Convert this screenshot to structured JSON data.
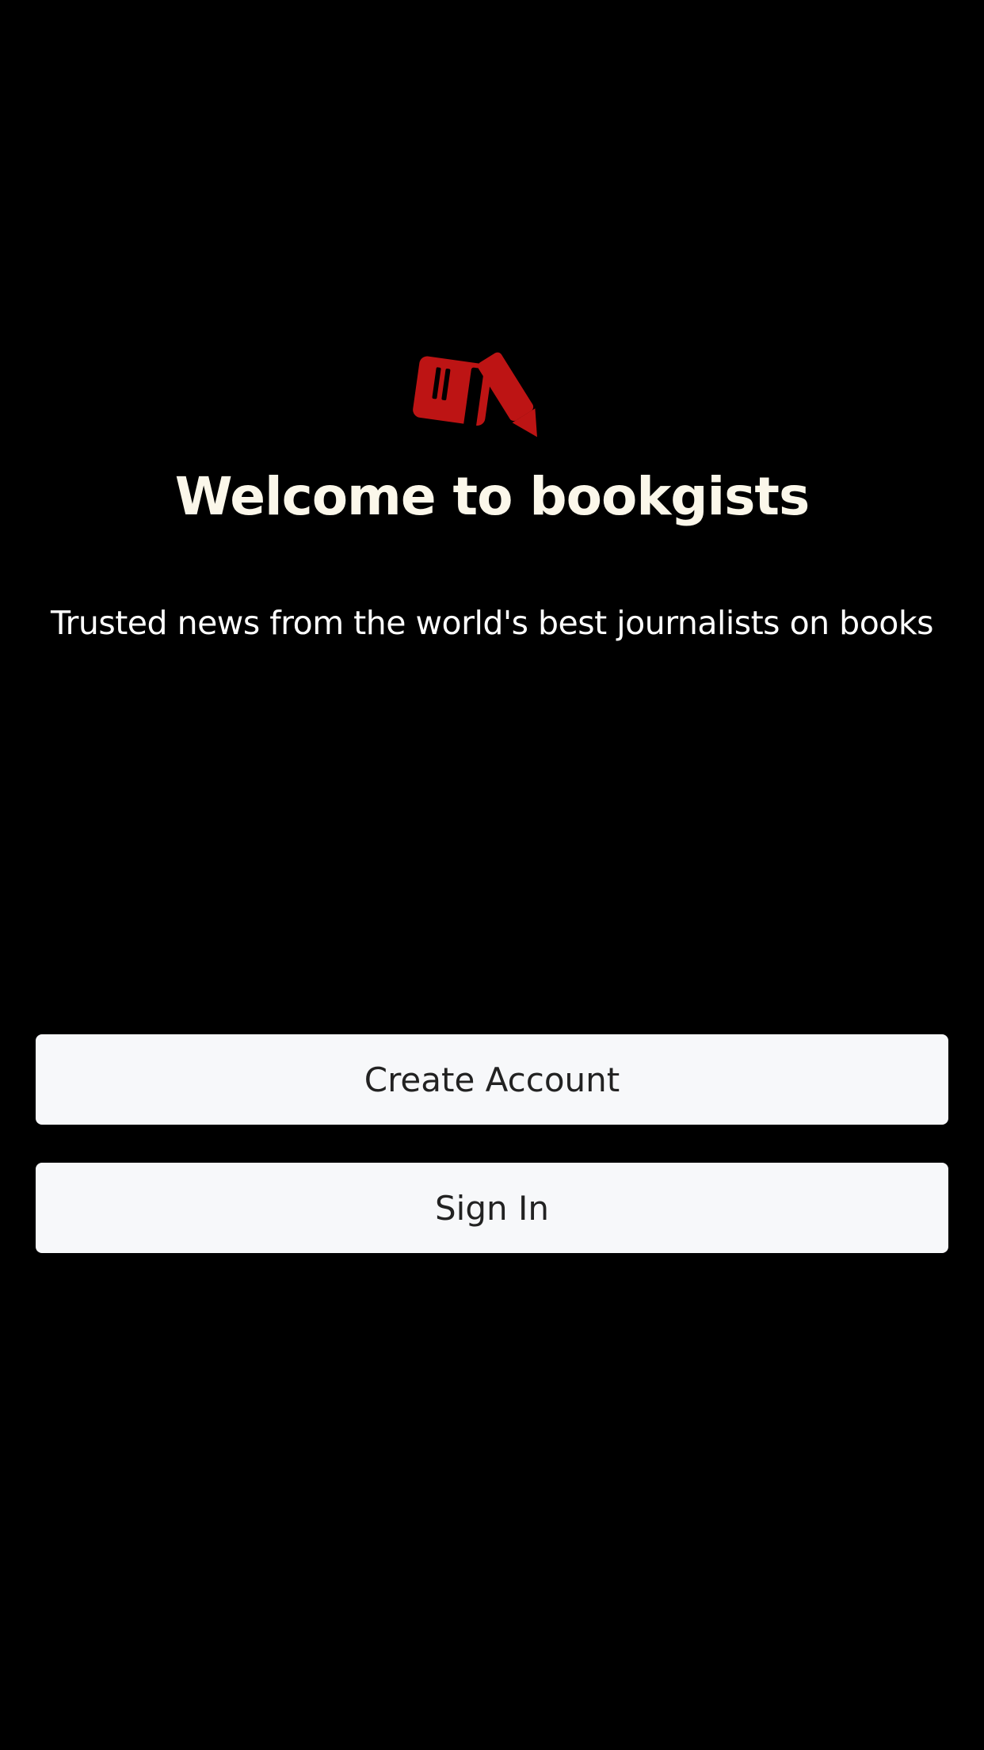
{
  "app": {
    "logo_icon": "book-and-pencil-icon",
    "brand_color": "#BD1414",
    "title": "Welcome to bookgists",
    "subtitle": "Trusted news from the world's best journalists on books"
  },
  "actions": {
    "create_account_label": "Create Account",
    "sign_in_label": "Sign In"
  },
  "colors": {
    "background": "#000000",
    "title_text": "#FBF7EA",
    "button_bg": "#F7F8FA",
    "button_text": "#222222"
  }
}
